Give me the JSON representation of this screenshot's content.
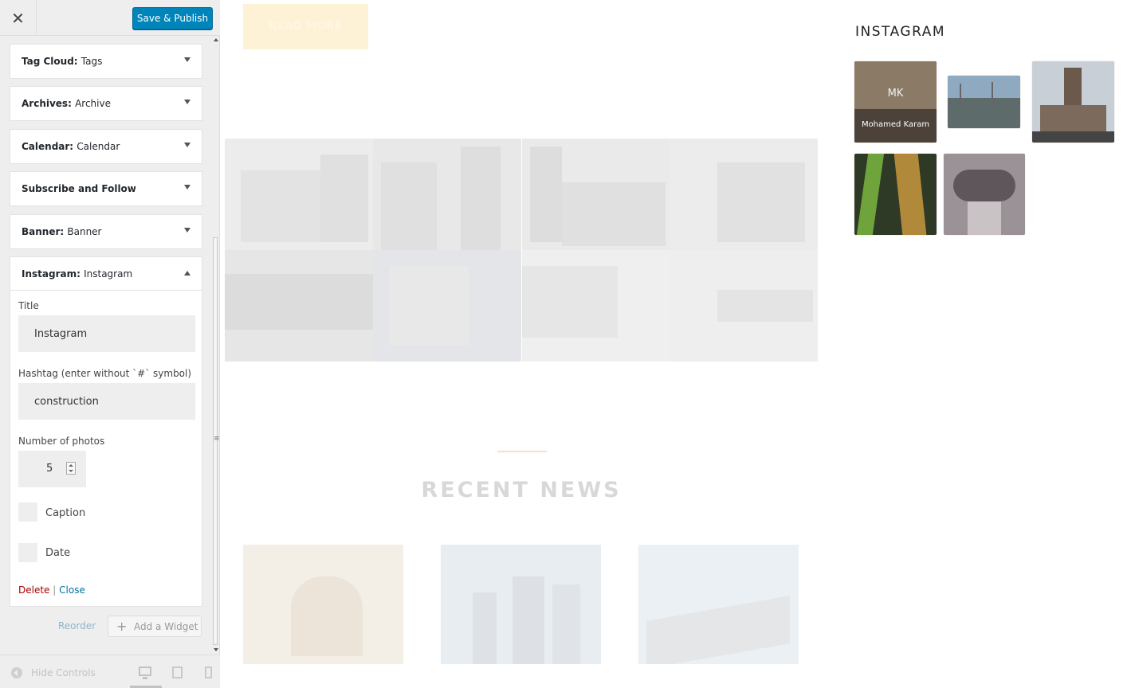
{
  "header": {
    "close_icon": "close-icon",
    "publish_label": "Save & Publish"
  },
  "widgets": [
    {
      "name": "Tag Cloud:",
      "title": "Tags"
    },
    {
      "name": "Archives:",
      "title": "Archive"
    },
    {
      "name": "Calendar:",
      "title": "Calendar"
    },
    {
      "name": "Subscribe and Follow",
      "title": ""
    },
    {
      "name": "Banner:",
      "title": "Banner"
    }
  ],
  "instagram_widget": {
    "name": "Instagram:",
    "title": "Instagram",
    "fields": {
      "title_label": "Title",
      "title_value": "Instagram",
      "hashtag_label": "Hashtag (enter without `#` symbol)",
      "hashtag_value": "construction",
      "photos_label": "Number of photos",
      "photos_value": "5",
      "caption_label": "Caption",
      "date_label": "Date"
    },
    "delete_label": "Delete",
    "separator": "|",
    "close_label": "Close"
  },
  "sidebar_actions": {
    "reorder_label": "Reorder",
    "add_widget_label": "Add a Widget"
  },
  "footer": {
    "hide_controls_label": "Hide Controls",
    "devices": [
      "desktop",
      "tablet",
      "mobile"
    ]
  },
  "preview": {
    "read_more_label": "READ MORE",
    "recent_news_title": "RECENT NEWS",
    "instagram_title": "INSTAGRAM",
    "instagram_caption": "Mohamed Karam",
    "instagram_logo_text": "MK"
  },
  "colors": {
    "publish": "#0085ba",
    "delete": "#aa0000",
    "link": "#0073aa",
    "accent": "#f7e3bd"
  }
}
